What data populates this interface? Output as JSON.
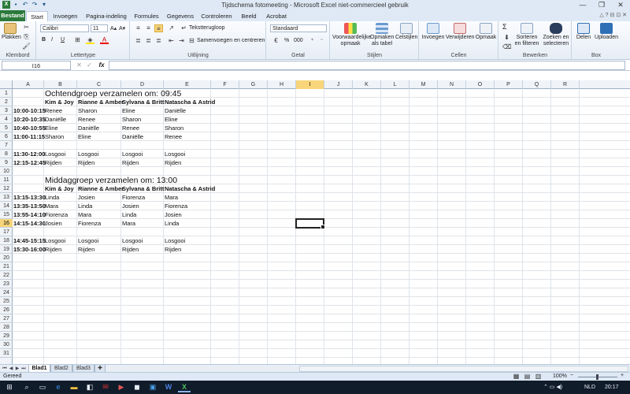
{
  "window": {
    "title": "Tijdschema fotomeeting  -  Microsoft Excel niet-commercieel gebruik",
    "quick_access": {
      "save_icon": "save-icon",
      "undo_glyph": "↶",
      "redo_glyph": "↷",
      "customize_glyph": "▾",
      "minimize_glyph": "—",
      "restore_glyph": "❐",
      "close_glyph": "✕"
    }
  },
  "ribbon": {
    "file_tab": "Bestand",
    "tabs": [
      "Start",
      "Invoegen",
      "Pagina-indeling",
      "Formules",
      "Gegevens",
      "Controleren",
      "Beeld",
      "Acrobat"
    ],
    "tab_icons": "△ ? ⊟ ⊡ ✕",
    "clipboard": {
      "paste": "Plakken",
      "group": "Klembord"
    },
    "font": {
      "name": "Calibri",
      "size": "11",
      "bold": "B",
      "italic": "I",
      "underline": "U",
      "grow": "A▴",
      "shrink": "A▾",
      "group": "Lettertype"
    },
    "alignment": {
      "wrap": "Tekstterugloop",
      "merge": "Samenvoegen en centreren",
      "group": "Uitlijning"
    },
    "number": {
      "format": "Standaard",
      "percent": "%",
      "thousands": "000",
      "group": "Getal"
    },
    "styles": {
      "conditional": "Voorwaardelijke opmaak",
      "as_table": "Opmaken als tabel",
      "cell_styles": "Celstijlen",
      "group": "Stijlen"
    },
    "cells": {
      "insert": "Invoegen",
      "delete": "Verwijderen",
      "format": "Opmaak",
      "group": "Cellen"
    },
    "editing": {
      "sum": "Σ",
      "sort": "Sorteren en filteren",
      "find": "Zoeken en selecteren",
      "group": "Bewerken"
    },
    "box": {
      "share": "Delen",
      "upload": "Uploaden",
      "group": "Box"
    }
  },
  "formula_bar": {
    "name_box": "I16",
    "fx": "fx",
    "value": ""
  },
  "grid": {
    "columns": [
      "A",
      "B",
      "C",
      "D",
      "E",
      "F",
      "G",
      "H",
      "I",
      "J",
      "K",
      "L",
      "M",
      "N",
      "O",
      "P",
      "Q",
      "R"
    ],
    "selected_column": "I",
    "rows": [
      "1",
      "2",
      "3",
      "4",
      "5",
      "6",
      "7",
      "8",
      "9",
      "10",
      "11",
      "12",
      "13",
      "14",
      "15",
      "16",
      "17",
      "18",
      "19",
      "20",
      "21",
      "22",
      "23",
      "24",
      "25",
      "26",
      "27",
      "28",
      "29",
      "30",
      "31"
    ],
    "selected_row": "16"
  },
  "sheet": {
    "title_morning": "Ochtendgroep verzamelen om: 09:45",
    "title_afternoon": "Middaggroep verzamelen om: 13:00",
    "headers": [
      "Kim & Joy",
      "Rianne & Amber",
      "Sylvana & Britt",
      "Natascha & Astrid"
    ],
    "morning": [
      [
        "10:00-10:15",
        "Renee",
        "Sharon",
        "Eline",
        "Daniëlle"
      ],
      [
        "10:20-10:35",
        "Daniëlle",
        "Renee",
        "Sharon",
        "Eline"
      ],
      [
        "10:40-10:55",
        "Eline",
        "Daniëlle",
        "Renee",
        "Sharon"
      ],
      [
        "11:00-11:15",
        "Sharon",
        "Eline",
        "Daniëlle",
        "Renee"
      ]
    ],
    "morning_extra": [
      [
        "11:30-12:00",
        "Losgooi",
        "Losgooi",
        "Losgooi",
        "Losgooi"
      ],
      [
        "12:15-12:45",
        "Rijden",
        "Rijden",
        "Rijden",
        "Rijden"
      ]
    ],
    "afternoon": [
      [
        "13:15-13:30",
        "Linda",
        "Josien",
        "Fiorenza",
        "Mara"
      ],
      [
        "13:35-13:50",
        "Mara",
        "Linda",
        "Josien",
        "Fiorenza"
      ],
      [
        "13:55-14:10",
        "Fiorenza",
        "Mara",
        "Linda",
        "Josien"
      ],
      [
        "14:15-14:30",
        "Josien",
        "Fiorenza",
        "Mara",
        "Linda"
      ]
    ],
    "afternoon_extra": [
      [
        "14:45-15:15",
        "Losgooi",
        "Losgooi",
        "Losgooi",
        "Losgooi"
      ],
      [
        "15:30-16:00",
        "Rijden",
        "Rijden",
        "Rijden",
        "Rijden"
      ]
    ]
  },
  "sheet_tabs": [
    "Blad1",
    "Blad2",
    "Blad3"
  ],
  "status": {
    "ready": "Gereed",
    "zoom": "100%",
    "zoom_minus": "−",
    "zoom_plus": "+"
  },
  "taskbar": {
    "lang": "NLD",
    "time": "20:17"
  },
  "colors": {
    "accent": "#2b7a3b",
    "selection": "#f8d57a",
    "taskbar": "#111c2a"
  }
}
